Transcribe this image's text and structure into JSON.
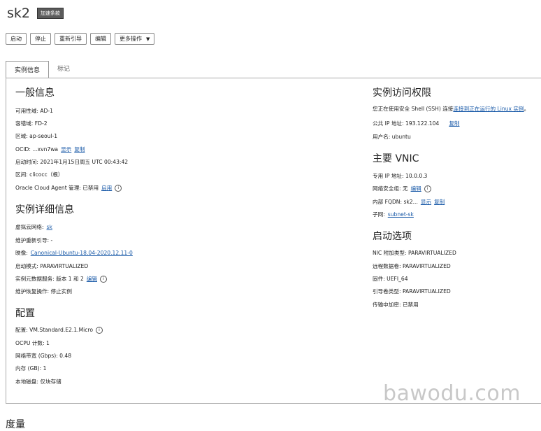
{
  "instance": {
    "name": "sk2",
    "badge": "加速条款"
  },
  "toolbar": {
    "start": "启动",
    "stop": "停止",
    "reboot": "重新引导",
    "edit": "编辑",
    "more": "更多操作"
  },
  "tabs": {
    "info": "实例信息",
    "tags": "标记"
  },
  "general": {
    "heading": "一般信息",
    "ad": "可用性域: AD-1",
    "fd": "容错域: FD-2",
    "region": "区域: ap-seoul-1",
    "ocid": "OCID: ...xvn7wa",
    "ocid_show": "显示",
    "ocid_copy": "复制",
    "launched": "启动时间: 2021年1月15日周五 UTC 00:43:42",
    "compartment": "区间: clicocc（根）",
    "agent": "Oracle Cloud Agent 管理: 已禁用",
    "agent_link": "启用"
  },
  "details": {
    "heading": "实例详细信息",
    "vcn": "虚拟云网络:",
    "vcn_link": "sk",
    "maint_reboot": "维护重新引导: -",
    "image": "映像:",
    "image_link": "Canonical-Ubuntu-18.04-2020.12.11-0",
    "launch_mode": "启动模式: PARAVIRTUALIZED",
    "metadata": "实例元数据服务: 版本 1 和 2",
    "metadata_link": "编辑",
    "recovery": "维护恢复操作: 停止实例"
  },
  "config": {
    "heading": "配置",
    "shape": "配置: VM.Standard.E2.1.Micro",
    "ocpu": "OCPU 计数: 1",
    "bandwidth": "网络带宽 (Gbps): 0.48",
    "memory": "内存 (GB): 1",
    "disk": "本地磁盘: 仅块存储"
  },
  "access": {
    "heading": "实例访问权限",
    "ssh_pre": "您正在使用安全 Shell (SSH) 连接",
    "ssh_link": "连接到正在运行的 Linux 实例",
    "ssh_post": "。",
    "public_ip": "公共 IP 地址: 193.122.104",
    "copy": "复制",
    "username": "用户名: ubuntu"
  },
  "vnic": {
    "heading": "主要 VNIC",
    "private_ip": "专用 IP 地址: 10.0.0.3",
    "nsg": "网络安全组: 无",
    "nsg_link": "编辑",
    "fqdn": "内部 FQDN: sk2...",
    "fqdn_show": "显示",
    "fqdn_copy": "复制",
    "subnet": "子网:",
    "subnet_link": "subnet-sk"
  },
  "boot": {
    "heading": "启动选项",
    "nic": "NIC 附加类型: PARAVIRTUALIZED",
    "remote": "远程数据卷: PARAVIRTUALIZED",
    "firmware": "固件: UEFI_64",
    "boot_volume": "引导卷类型: PARAVIRTUALIZED",
    "encryption": "传输中加密: 已禁用"
  },
  "watermark": "bawodu.com",
  "next_heading": "度量"
}
